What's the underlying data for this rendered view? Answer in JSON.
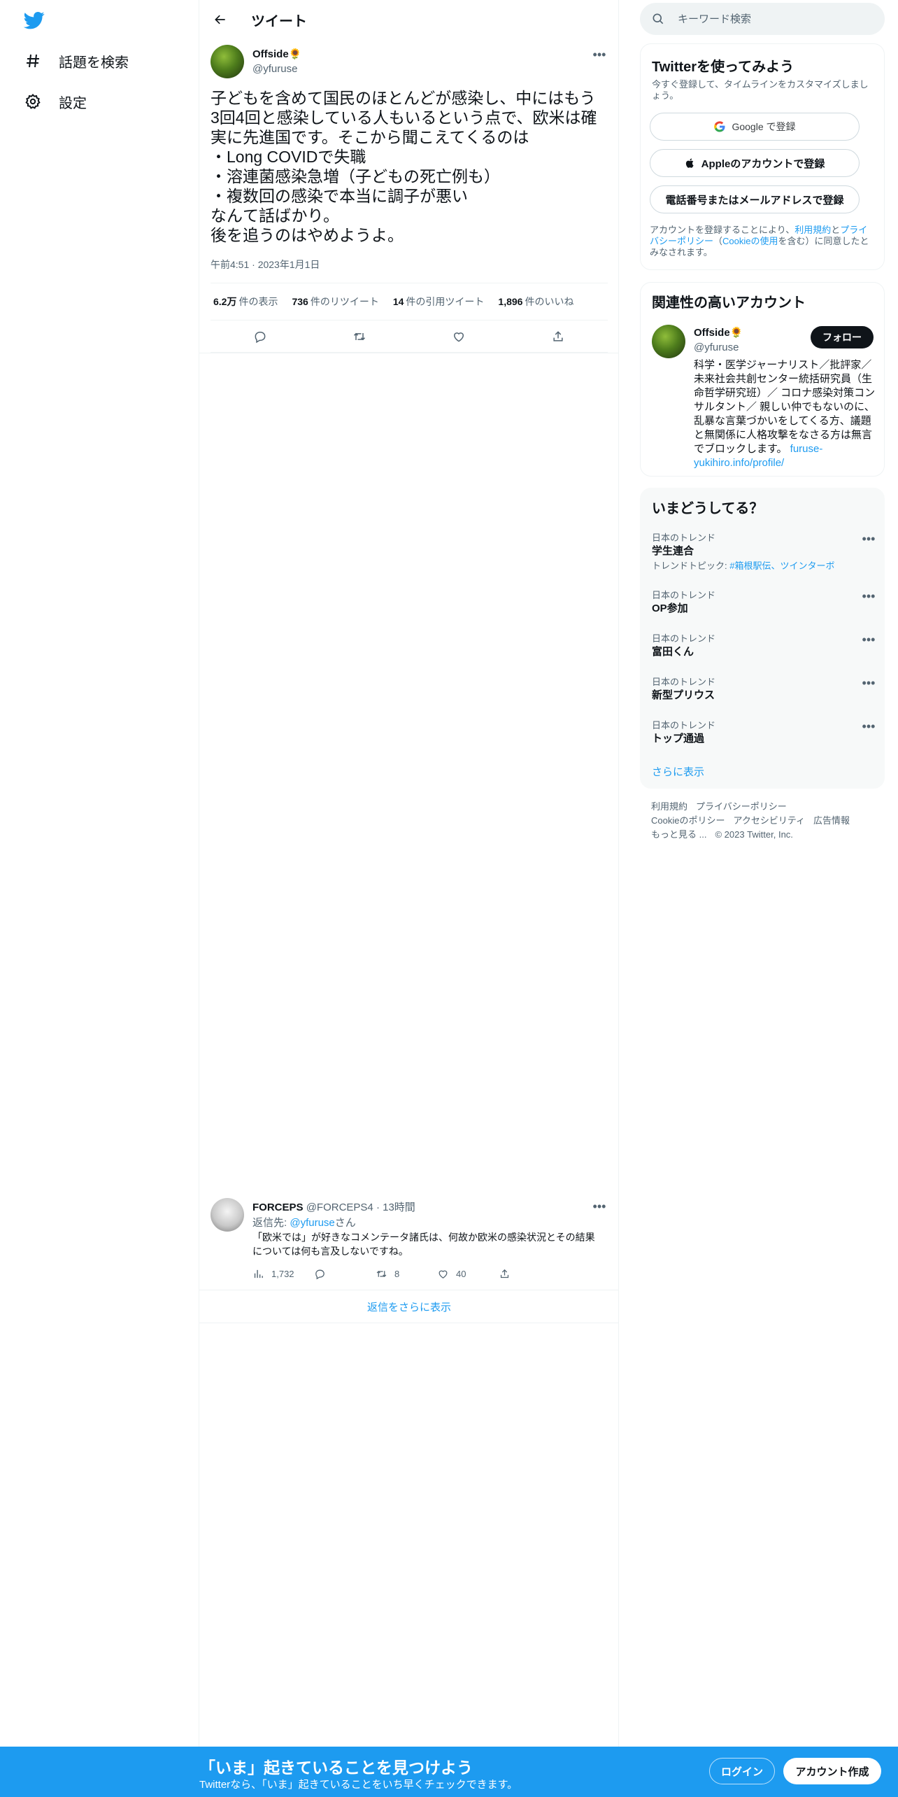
{
  "nav": {
    "explore": "話題を検索",
    "settings": "設定"
  },
  "header": {
    "title": "ツイート"
  },
  "tweet": {
    "name": "Offside🌻",
    "handle": "@yfuruse",
    "text": "子どもを含めて国民のほとんどが感染し、中にはもう3回4回と感染している人もいるという点で、欧米は確実に先進国です。そこから聞こえてくるのは\n・Long COVIDで失職\n・溶連菌感染急増（子どもの死亡例も）\n・複数回の感染で本当に調子が悪い\nなんて話ばかり。\n後を追うのはやめようよ。",
    "time": "午前4:51 · 2023年1月1日",
    "stats": {
      "views_num": "6.2万",
      "views_label": "件の表示",
      "retweets_num": "736",
      "retweets_label": "件のリツイート",
      "quotes_num": "14",
      "quotes_label": "件の引用ツイート",
      "likes_num": "1,896",
      "likes_label": "件のいいね"
    }
  },
  "reply": {
    "name": "FORCEPS",
    "handle": "@FORCEPS4",
    "dot": "·",
    "time": "13時間",
    "reply_to_label": "返信先: ",
    "reply_to_handle": "@yfuruse",
    "reply_to_suffix": "さん",
    "text": "「欧米では」が好きなコメンテータ諸氏は、何故か欧米の感染状況とその結果については何も言及しないですね。",
    "views": "1,732",
    "retweets": "8",
    "likes": "40"
  },
  "show_more_replies": "返信をさらに表示",
  "search": {
    "placeholder": "キーワード検索"
  },
  "signup_card": {
    "title": "Twitterを使ってみよう",
    "subtitle": "今すぐ登録して、タイムラインをカスタマイズしましょう。",
    "google": "Google で登録",
    "apple": "Appleのアカウントで登録",
    "phone_email": "電話番号またはメールアドレスで登録",
    "legal_1": "アカウントを登録することにより、",
    "legal_terms": "利用規約",
    "legal_and": "と",
    "legal_privacy": "プライバシーポリシー",
    "legal_open": "（",
    "legal_cookie": "Cookieの使用",
    "legal_2": "を含む）に同意したとみなされます。"
  },
  "related": {
    "title": "関連性の高いアカウント",
    "name": "Offside🌻",
    "handle": "@yfuruse",
    "follow": "フォロー",
    "bio": "科学・医学ジャーナリスト／批評家／未来社会共創センター統括研究員（生命哲学研究班）／ コロナ感染対策コンサルタント／ 親しい仲でもないのに、乱暴な言葉づかいをしてくる方、議題と無関係に人格攻撃をなさる方は無言でブロックします。 ",
    "bio_link": "furuse-yukihiro.info/profile/"
  },
  "trends": {
    "title": "いまどうしてる？",
    "items": [
      {
        "category": "日本のトレンド",
        "name": "学生連合",
        "topics_label": "トレンドトピック: ",
        "topics": "#箱根駅伝、ツインターボ"
      },
      {
        "category": "日本のトレンド",
        "name": "OP参加"
      },
      {
        "category": "日本のトレンド",
        "name": "富田くん"
      },
      {
        "category": "日本のトレンド",
        "name": "新型プリウス"
      },
      {
        "category": "日本のトレンド",
        "name": "トップ通過"
      }
    ],
    "show_more": "さらに表示"
  },
  "footer": {
    "terms": "利用規約",
    "privacy": "プライバシーポリシー",
    "cookie": "Cookieのポリシー",
    "accessibility": "アクセシビリティ",
    "ads": "広告情報",
    "more": "もっと見る ...",
    "copyright": "© 2023 Twitter, Inc."
  },
  "bottom_bar": {
    "title": "「いま」起きていることを見つけよう",
    "subtitle": "Twitterなら、「いま」起きていることをいち早くチェックできます。",
    "login": "ログイン",
    "signup": "アカウント作成"
  },
  "colors": {
    "accent": "#1d9bf0",
    "text": "#0f1419",
    "secondary": "#536471",
    "border": "#eff3f4"
  }
}
